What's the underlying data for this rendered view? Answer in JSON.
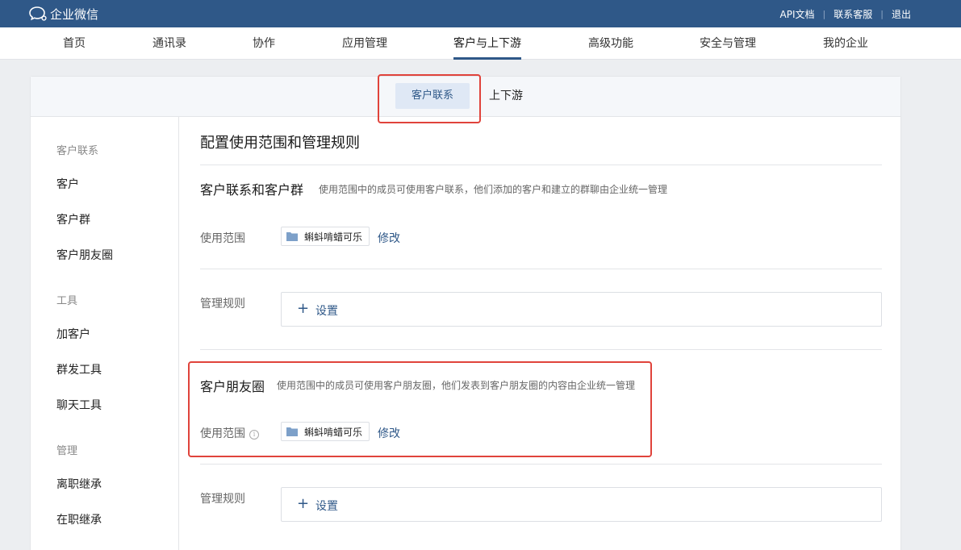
{
  "brand": {
    "name": "企业微信"
  },
  "toplinks": [
    "API文档",
    "联系客服",
    "退出"
  ],
  "mainnav": [
    "首页",
    "通讯录",
    "协作",
    "应用管理",
    "客户与上下游",
    "高级功能",
    "安全与管理",
    "我的企业"
  ],
  "mainnav_active": "客户与上下游",
  "subtabs": {
    "active": "客户联系",
    "other": "上下游"
  },
  "sidebar": {
    "group1": "客户联系",
    "group1_items": [
      "客户",
      "客户群",
      "客户朋友圈"
    ],
    "group2": "工具",
    "group2_items": [
      "加客户",
      "群发工具",
      "聊天工具"
    ],
    "group3": "管理",
    "group3_items": [
      "离职继承",
      "在职继承"
    ]
  },
  "content": {
    "title": "配置使用范围和管理规则",
    "section1": {
      "title": "客户联系和客户群",
      "desc": "使用范围中的成员可使用客户联系，他们添加的客户和建立的群聊由企业统一管理",
      "scope_label": "使用范围",
      "scope_value": "蝌蚪啃蜡可乐",
      "edit_label": "修改",
      "rule_label": "管理规则",
      "set_label": "设置"
    },
    "section2": {
      "title": "客户朋友圈",
      "desc": "使用范围中的成员可使用客户朋友圈，他们发表到客户朋友圈的内容由企业统一管理",
      "scope_label": "使用范围",
      "info_glyph": "i",
      "scope_value": "蝌蚪啃蜡可乐",
      "edit_label": "修改",
      "rule_label": "管理规则",
      "set_label": "设置"
    }
  },
  "colors": {
    "topbar": "#2f5888",
    "accent": "#2f5888",
    "highlight_box": "#e0433b",
    "background": "#eceef1"
  },
  "icons": [
    "chat-bubble-logo-icon",
    "folder-icon",
    "plus-icon",
    "info-icon"
  ]
}
